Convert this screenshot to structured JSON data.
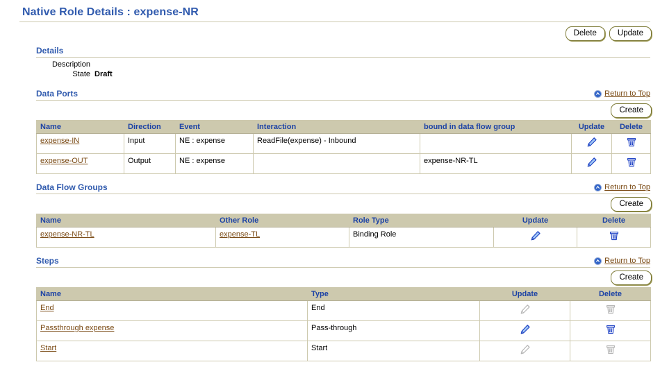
{
  "page": {
    "title": "Native Role Details : expense-NR"
  },
  "top_actions": {
    "delete_label": "Delete",
    "update_label": "Update"
  },
  "details": {
    "heading": "Details",
    "rows": [
      {
        "label": "Description",
        "value": ""
      },
      {
        "label": "State",
        "value": "Draft"
      }
    ]
  },
  "common": {
    "return_to_top": "Return to Top",
    "create_label": "Create"
  },
  "data_ports": {
    "heading": "Data Ports",
    "columns": [
      "Name",
      "Direction",
      "Event",
      "Interaction",
      "bound in data flow group",
      "Update",
      "Delete"
    ],
    "rows": [
      {
        "name": "expense-IN",
        "direction": "Input",
        "event": "NE : expense",
        "interaction": "ReadFile(expense) - Inbound",
        "bound_in_data_flow_group": "",
        "update_enabled": true,
        "delete_enabled": true
      },
      {
        "name": "expense-OUT",
        "direction": "Output",
        "event": "NE : expense",
        "interaction": "",
        "bound_in_data_flow_group": "expense-NR-TL",
        "update_enabled": true,
        "delete_enabled": true
      }
    ]
  },
  "data_flow_groups": {
    "heading": "Data Flow Groups",
    "columns": [
      "Name",
      "Other Role",
      "Role Type",
      "Update",
      "Delete"
    ],
    "rows": [
      {
        "name": "expense-NR-TL",
        "other_role": "expense-TL",
        "role_type": "Binding Role",
        "update_enabled": true,
        "delete_enabled": true
      }
    ]
  },
  "steps": {
    "heading": "Steps",
    "columns": [
      "Name",
      "Type",
      "Update",
      "Delete"
    ],
    "rows": [
      {
        "name": "End",
        "type": "End",
        "update_enabled": false,
        "delete_enabled": false
      },
      {
        "name": "Passthrough expense",
        "type": "Pass-through",
        "update_enabled": true,
        "delete_enabled": true
      },
      {
        "name": "Start",
        "type": "Start",
        "update_enabled": false,
        "delete_enabled": false
      }
    ]
  },
  "colors": {
    "heading_blue": "#315bae",
    "table_header_bg": "#cdc9ae",
    "table_header_text": "#1d43a5",
    "link_brown": "#7a4a14",
    "button_border": "#7d7a36",
    "icon_blue": "#1b48d0",
    "icon_disabled": "#b0b0b0"
  },
  "icons": {
    "return_top": "circle-up-arrow-icon",
    "update": "pencil-icon",
    "delete": "trash-icon"
  }
}
